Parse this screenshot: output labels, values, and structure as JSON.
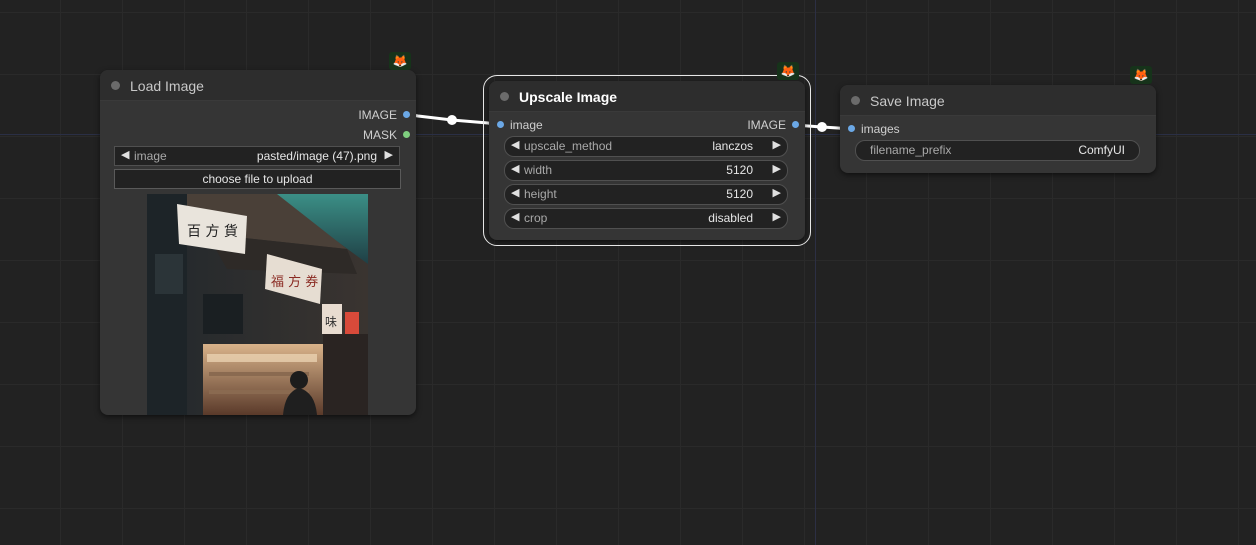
{
  "nodes": {
    "load_image": {
      "title": "Load Image",
      "badge": "🦊",
      "outputs": [
        {
          "label": "IMAGE",
          "color": "#6ba8e6"
        },
        {
          "label": "MASK",
          "color": "#7fcf7f"
        }
      ],
      "widget": {
        "label": "image",
        "value": "pasted/image (47).png"
      },
      "upload_button": "choose file to upload",
      "preview": {
        "sign_1": "百 方 貨",
        "sign_2": "福 方 券",
        "sign_3": "味"
      }
    },
    "upscale_image": {
      "title": "Upscale Image",
      "badge": "🦊",
      "input": {
        "label": "image",
        "color": "#6ba8e6"
      },
      "output": {
        "label": "IMAGE",
        "color": "#6ba8e6"
      },
      "widgets": [
        {
          "label": "upscale_method",
          "value": "lanczos"
        },
        {
          "label": "width",
          "value": "5120"
        },
        {
          "label": "height",
          "value": "5120"
        },
        {
          "label": "crop",
          "value": "disabled"
        }
      ]
    },
    "save_image": {
      "title": "Save Image",
      "badge": "🦊",
      "input": {
        "label": "images",
        "color": "#6ba8e6"
      },
      "widget": {
        "label": "filename_prefix",
        "value": "ComfyUI"
      }
    }
  },
  "colors": {
    "canvas_bg": "#222222",
    "node_bg": "#353535",
    "node_header": "#2d2d2d",
    "link": "#ffffff",
    "image_slot": "#6ba8e6",
    "mask_slot": "#7fcf7f"
  }
}
